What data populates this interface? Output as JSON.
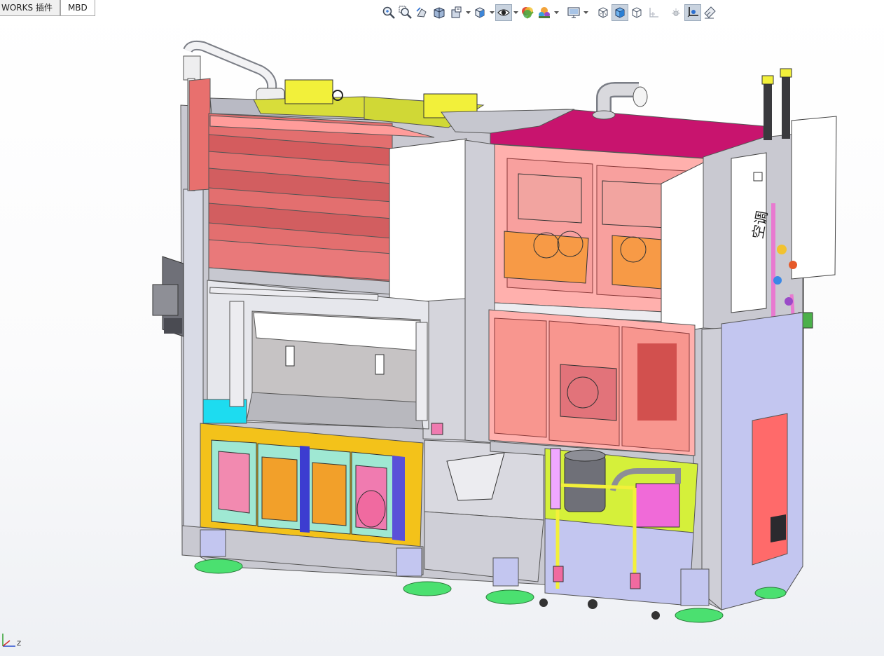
{
  "tabs": [
    {
      "label": "WORKS 插件"
    },
    {
      "label": "MBD"
    }
  ],
  "toolbar": [
    "zoom-to-fit-icon",
    "zoom-to-area-icon",
    "previous-view-icon",
    "section-view-icon",
    "dynamic-annotation-icon",
    "view-orientation-icon",
    "display-style-icon",
    "hide-show-items-icon",
    "edit-appearance-icon",
    "apply-scene-icon",
    "view-settings-icon",
    "isometric-view-icon",
    "shaded-with-edges-icon",
    "wireframe-icon",
    "view-plane-icon",
    "view-lights-icon",
    "rotate-view-icon",
    "eraser-icon"
  ],
  "model": {
    "side_label": "空调"
  },
  "triad": {
    "z_label": "Z"
  },
  "colors": {
    "frame": "#c9c9d1",
    "red_panel": "#e36f6f",
    "glass_red": "#ffb0ad",
    "magenta": "#c8146e",
    "yellow": "#e2e63a",
    "cabinet_teal": "#9fe8d3",
    "cabinet_frame": "#f3c21a",
    "blue_strip": "#3c3cd0",
    "orange": "#f2a02a",
    "foot_green": "#4be070",
    "lavender": "#c3c6f0"
  }
}
